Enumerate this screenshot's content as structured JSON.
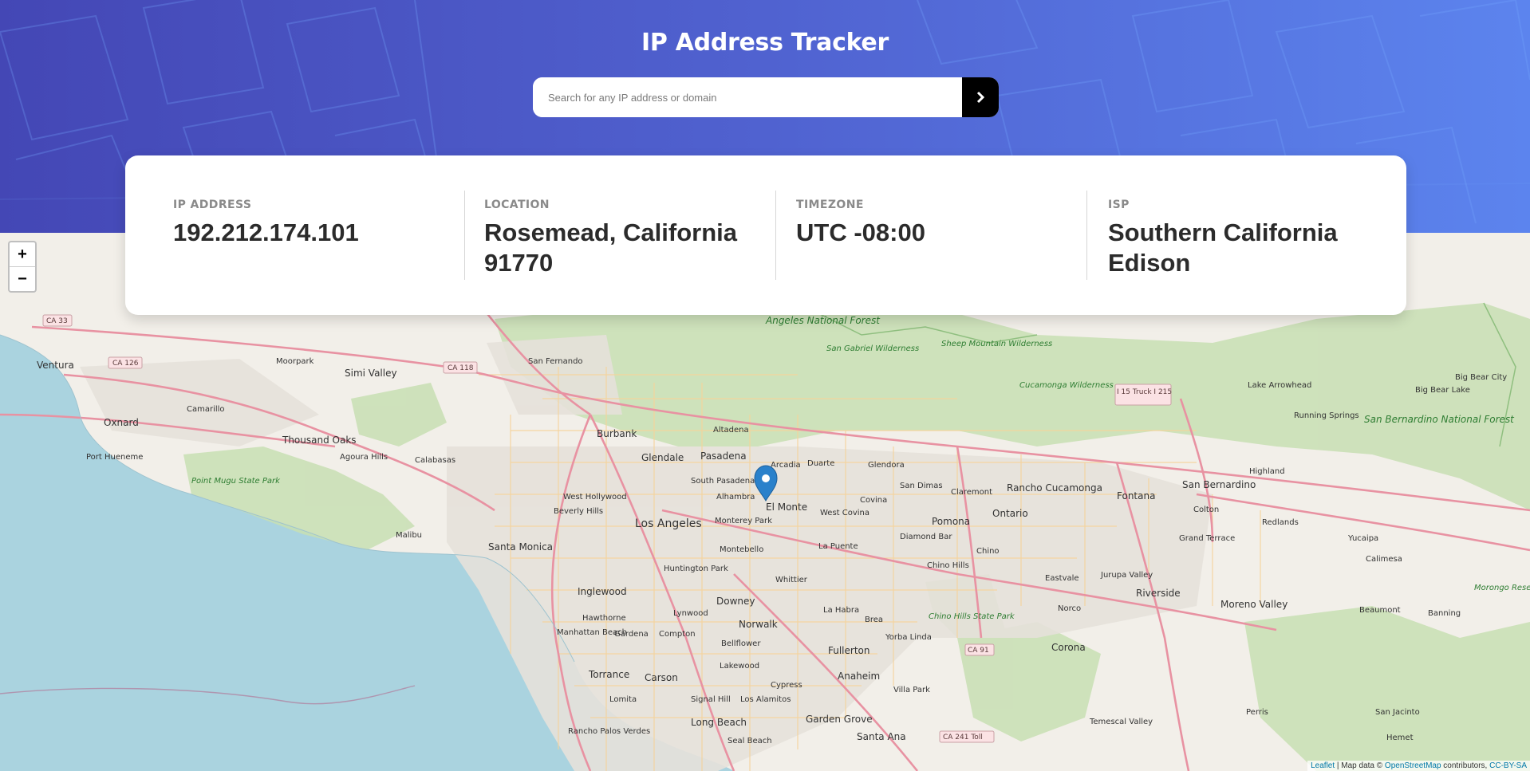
{
  "app": {
    "title": "IP Address Tracker"
  },
  "search": {
    "placeholder": "Search for any IP address or domain",
    "value": "",
    "button_icon": "chevron-right-icon"
  },
  "info": [
    {
      "label": "IP ADDRESS",
      "value": "192.212.174.101"
    },
    {
      "label": "LOCATION",
      "value": "Rosemead, California 91770"
    },
    {
      "label": "TIMEZONE",
      "value": "UTC -08:00"
    },
    {
      "label": "ISP",
      "value": "Southern California Edison"
    }
  ],
  "map": {
    "zoom_in": "+",
    "zoom_out": "−",
    "marker_icon": "map-marker-icon",
    "attribution": {
      "leaflet": "Leaflet",
      "sep": " | Map data © ",
      "osm": "OpenStreetMap",
      "contrib": " contributors, ",
      "license": "CC-BY-SA"
    },
    "labels": {
      "ventura": "Ventura",
      "oxnard": "Oxnard",
      "port_hueneme": "Port Hueneme",
      "camarillo": "Camarillo",
      "moorpark": "Moorpark",
      "simi_valley": "Simi Valley",
      "thousand_oaks": "Thousand Oaks",
      "agoura_hills": "Agoura Hills",
      "calabasas": "Calabasas",
      "malibu": "Malibu",
      "san_fernando": "San Fernando",
      "burbank": "Burbank",
      "glendale": "Glendale",
      "pasadena": "Pasadena",
      "altadena": "Altadena",
      "arcadia": "Arcadia",
      "south_pasadena": "South Pasadena",
      "alhambra": "Alhambra",
      "el_monte": "El Monte",
      "west_hollywood": "West Hollywood",
      "beverly_hills": "Beverly Hills",
      "los_angeles": "Los Angeles",
      "monterey_park": "Monterey Park",
      "montebello": "Montebello",
      "santa_monica": "Santa Monica",
      "huntington_park": "Huntington Park",
      "inglewood": "Inglewood",
      "hawthorne": "Hawthorne",
      "manhattan_beach": "Manhattan Beach",
      "torrance": "Torrance",
      "carson": "Carson",
      "long_beach": "Long Beach",
      "downey": "Downey",
      "norwalk": "Norwalk",
      "compton": "Compton",
      "gardena": "Gardena",
      "lynwood": "Lynwood",
      "bellflower": "Bellflower",
      "lakewood": "Lakewood",
      "cypress": "Cypress",
      "los_alamitos": "Los Alamitos",
      "signal_hill": "Signal Hill",
      "lomita": "Lomita",
      "rancho_palos_verdes": "Rancho Palos Verdes",
      "seal_beach": "Seal Beach",
      "garden_grove": "Garden Grove",
      "santa_ana": "Santa Ana",
      "anaheim": "Anaheim",
      "fullerton": "Fullerton",
      "la_habra": "La Habra",
      "brea": "Brea",
      "whittier": "Whittier",
      "la_puente": "La Puente",
      "west_covina": "West Covina",
      "covina": "Covina",
      "duarte": "Duarte",
      "glendora": "Glendora",
      "san_dimas": "San Dimas",
      "claremont": "Claremont",
      "pomona": "Pomona",
      "diamond_bar": "Diamond Bar",
      "chino_hills": "Chino Hills",
      "chino": "Chino",
      "ontario": "Ontario",
      "rancho_cucamonga": "Rancho Cucamonga",
      "fontana": "Fontana",
      "san_bernardino": "San Bernardino",
      "highland": "Highland",
      "colton": "Colton",
      "redlands": "Redlands",
      "grand_terrace": "Grand Terrace",
      "yucaipa": "Yucaipa",
      "calimesa": "Calimesa",
      "jurupa_valley": "Jurupa Valley",
      "eastvale": "Eastvale",
      "norco": "Norco",
      "riverside": "Riverside",
      "corona": "Corona",
      "moreno_valley": "Moreno Valley",
      "beaumont": "Beaumont",
      "banning": "Banning",
      "perris": "Perris",
      "san_jacinto": "San Jacinto",
      "hemet": "Hemet",
      "temescal_valley": "Temescal Valley",
      "yorba_linda": "Yorba Linda",
      "villa_park": "Villa Park",
      "lake_arrowhead": "Lake Arrowhead",
      "running_springs": "Running Springs",
      "big_bear_city": "Big Bear City",
      "big_bear_lake": "Big Bear Lake",
      "angeles_nf": "Angeles National Forest",
      "san_gabriel_w": "San Gabriel Wilderness",
      "sheep_mountain_w": "Sheep Mountain Wilderness",
      "cucamonga_w": "Cucamonga Wilderness",
      "san_bernardino_nf": "San Bernardino National Forest",
      "point_mugu": "Point Mugu State Park",
      "chino_hills_sp": "Chino Hills State Park",
      "morongo": "Morongo Reservation",
      "ca33": "CA 33",
      "ca126": "CA 126",
      "ca118": "CA 118",
      "i15": "I 15 Truck I 215",
      "ca91": "CA 91",
      "ca241": "CA 241 Toll"
    }
  },
  "colors": {
    "header_start": "#4447b5",
    "header_end": "#5c84ee",
    "ocean": "#aad3df",
    "land": "#f2efe9",
    "park": "#c8dfb3",
    "road_major": "#e892a2",
    "road_minor": "#f6d39a",
    "marker": "#2a81cb"
  }
}
